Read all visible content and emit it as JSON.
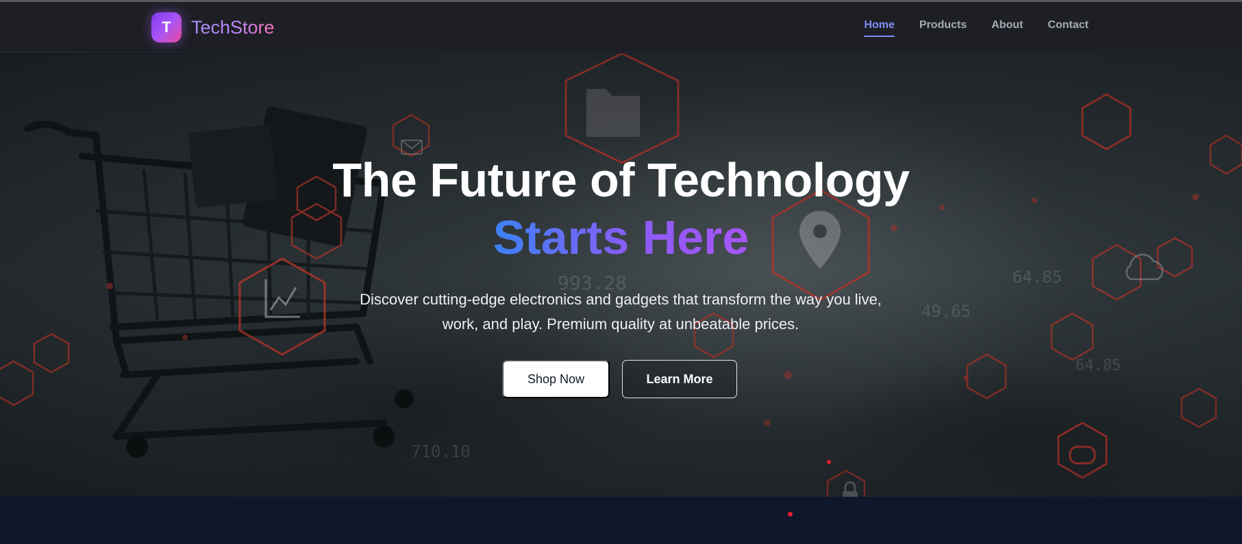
{
  "brand": {
    "logo_letter": "T",
    "name": "TechStore"
  },
  "nav": {
    "links": [
      {
        "label": "Home",
        "active": true
      },
      {
        "label": "Products",
        "active": false
      },
      {
        "label": "About",
        "active": false
      },
      {
        "label": "Contact",
        "active": false
      }
    ]
  },
  "hero": {
    "title": "The Future of Technology",
    "subtitle": "Starts Here",
    "description": "Discover cutting-edge electronics and gadgets that transform the way you live, work, and play. Premium quality at unbeatable prices.",
    "primary_button": "Shop Now",
    "secondary_button": "Learn More",
    "background_numbers": [
      "993.28",
      "49.65",
      "64.85",
      "710.10",
      "64.85"
    ]
  },
  "colors": {
    "accent": "#818cf8",
    "brand_gradient_start": "#7c3aed",
    "brand_gradient_end": "#ec4899",
    "hex_outline": "#c2372b",
    "page_background": "#0f172a"
  },
  "icons": [
    "shopping-cart",
    "folder-icon",
    "location-pin-icon",
    "chart-icon",
    "mail-icon",
    "chat-icon",
    "cloud-icon",
    "lock-icon",
    "search-icon"
  ]
}
